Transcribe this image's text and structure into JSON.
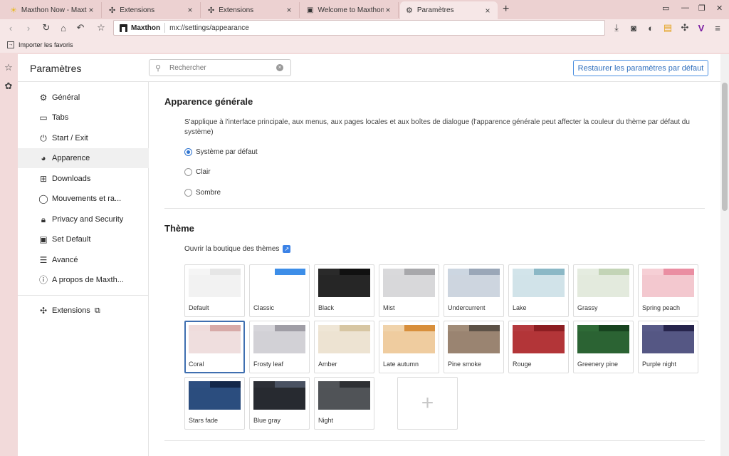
{
  "tabs": [
    {
      "title": "Maxthon Now - Maxtho",
      "icon": "sun-icon",
      "active": false
    },
    {
      "title": "Extensions",
      "icon": "puzzle-icon",
      "active": false
    },
    {
      "title": "Extensions",
      "icon": "puzzle-icon",
      "active": false
    },
    {
      "title": "Welcome to Maxthon Br",
      "icon": "page-icon",
      "active": false
    },
    {
      "title": "Paramètres",
      "icon": "gear-icon",
      "active": true
    }
  ],
  "omnibox": {
    "site": "Maxthon",
    "url": "mx://settings/appearance"
  },
  "bookmarks": {
    "import_label": "Importer les favoris"
  },
  "settings": {
    "title": "Paramètres",
    "search_placeholder": "Rechercher",
    "restore_label": "Restaurer les paramètres par défaut",
    "nav": [
      {
        "label": "Général",
        "icon": "gear-icon"
      },
      {
        "label": "Tabs",
        "icon": "tabs-icon"
      },
      {
        "label": "Start / Exit",
        "icon": "power-icon"
      },
      {
        "label": "Apparence",
        "icon": "palette-icon"
      },
      {
        "label": "Downloads",
        "icon": "download-folder-icon"
      },
      {
        "label": "Mouvements et ra...",
        "icon": "mouse-icon"
      },
      {
        "label": "Privacy and Security",
        "icon": "lock-icon"
      },
      {
        "label": "Set Default",
        "icon": "browser-icon"
      },
      {
        "label": "Avancé",
        "icon": "sliders-icon"
      },
      {
        "label": "A propos de Maxth...",
        "icon": "info-icon"
      }
    ],
    "extensions_label": "Extensions"
  },
  "appearance": {
    "heading": "Apparence générale",
    "description": "S'applique à l'interface principale, aux menus, aux pages locales et aux boîtes de dialogue (l'apparence générale peut affecter la couleur du thème par défaut du système)",
    "options": [
      "Système par défaut",
      "Clair",
      "Sombre"
    ],
    "selected": "Système par défaut"
  },
  "theme": {
    "heading": "Thème",
    "shop_link": "Ouvrir la boutique des thèmes",
    "selected": "Coral",
    "themes": [
      {
        "name": "Default",
        "bar": "#e6e6e6",
        "tab": "#f5f5f5",
        "body": "#f2f2f2"
      },
      {
        "name": "Classic",
        "bar": "#3d8ee8",
        "tab": "#ffffff",
        "body": "#ffffff"
      },
      {
        "name": "Black",
        "bar": "#111111",
        "tab": "#2a2a2a",
        "body": "#262626"
      },
      {
        "name": "Mist",
        "bar": "#a8a8ab",
        "tab": "#d9d9db",
        "body": "#d8d8da"
      },
      {
        "name": "Undercurrent",
        "bar": "#9aa7b8",
        "tab": "#ccd6e1",
        "body": "#cdd5df"
      },
      {
        "name": "Lake",
        "bar": "#8bb8c6",
        "tab": "#d2e4ea",
        "body": "#d1e3e9"
      },
      {
        "name": "Grassy",
        "bar": "#c3d4b6",
        "tab": "#e5ece0",
        "body": "#e3eadd"
      },
      {
        "name": "Spring peach",
        "bar": "#ea8ea2",
        "tab": "#f6cfd5",
        "body": "#f3c8cf"
      },
      {
        "name": "Coral",
        "bar": "#d7aaa8",
        "tab": "#efdcdc",
        "body": "#efdede"
      },
      {
        "name": "Frosty leaf",
        "bar": "#a09ea6",
        "tab": "#d6d5da",
        "body": "#d2d1d6"
      },
      {
        "name": "Amber",
        "bar": "#d7c6a3",
        "tab": "#efe6d6",
        "body": "#ede3d2"
      },
      {
        "name": "Late autumn",
        "bar": "#d88f3c",
        "tab": "#f0d3ab",
        "body": "#efcc9f"
      },
      {
        "name": "Pine smoke",
        "bar": "#5d5247",
        "tab": "#a18c78",
        "body": "#9a8471"
      },
      {
        "name": "Rouge",
        "bar": "#8d1e22",
        "tab": "#b53a3e",
        "body": "#b33538"
      },
      {
        "name": "Greenery pine",
        "bar": "#17431f",
        "tab": "#2e6a36",
        "body": "#2b6333"
      },
      {
        "name": "Purple night",
        "bar": "#26244c",
        "tab": "#585a88",
        "body": "#555784"
      },
      {
        "name": "Stars fade",
        "bar": "#14284a",
        "tab": "#2d4e80",
        "body": "#2b4d7e"
      },
      {
        "name": "Blue gray",
        "bar": "#4a5262",
        "tab": "#2c2f36",
        "body": "#272a30"
      },
      {
        "name": "Night",
        "bar": "#2e3034",
        "tab": "#515458",
        "body": "#505357"
      }
    ]
  }
}
